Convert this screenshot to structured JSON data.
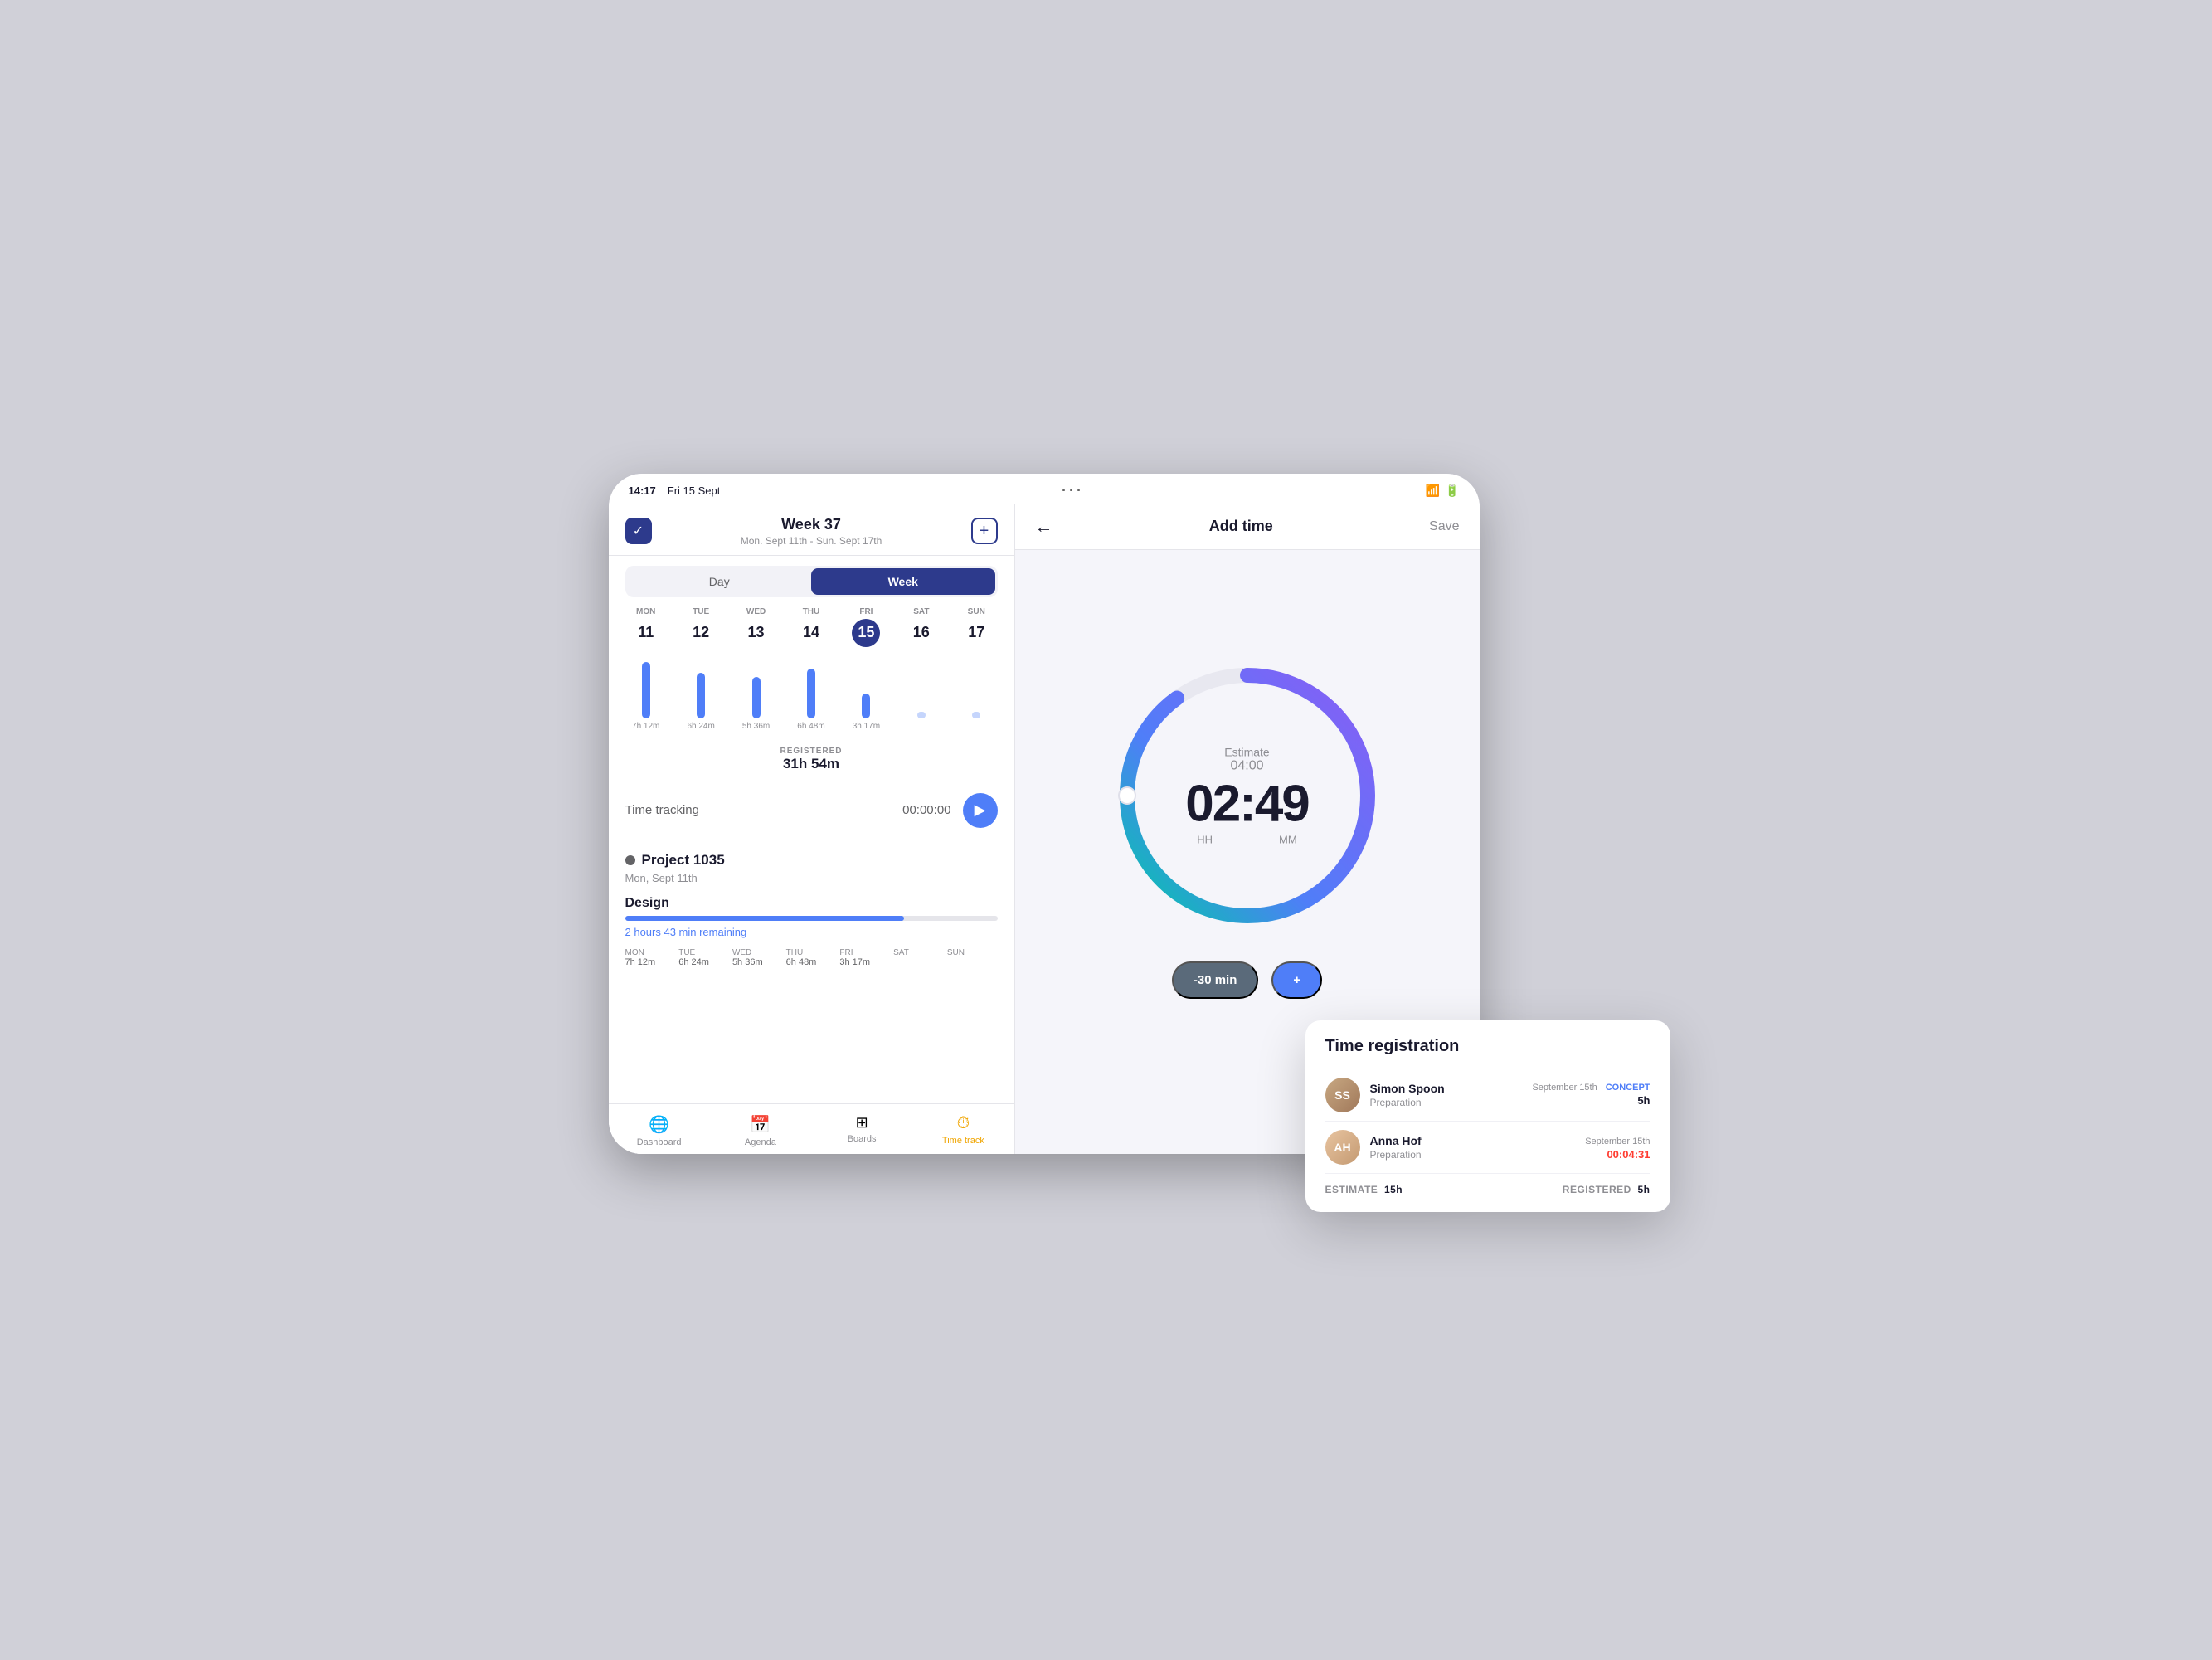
{
  "statusBar": {
    "time": "14:17",
    "date": "Fri 15 Sept"
  },
  "leftPanel": {
    "weekTitle": "Week 37",
    "weekSubtitle": "Mon. Sept 11th - Sun. Sept 17th",
    "toggleDay": "Day",
    "toggleWeek": "Week",
    "days": [
      {
        "label": "MON",
        "num": "11",
        "bar": 68,
        "time": "7h 12m",
        "active": false,
        "today": false
      },
      {
        "label": "TUE",
        "num": "12",
        "bar": 55,
        "time": "6h 24m",
        "active": false,
        "today": false
      },
      {
        "label": "WED",
        "num": "13",
        "bar": 50,
        "time": "5h 36m",
        "active": false,
        "today": false
      },
      {
        "label": "THU",
        "num": "14",
        "bar": 60,
        "time": "6h 48m",
        "active": false,
        "today": false
      },
      {
        "label": "FRI",
        "num": "15",
        "bar": 30,
        "time": "3h 17m",
        "active": true,
        "today": true
      },
      {
        "label": "SAT",
        "num": "16",
        "bar": 0,
        "time": "",
        "active": false,
        "today": false
      },
      {
        "label": "SUN",
        "num": "17",
        "bar": 0,
        "time": "",
        "active": false,
        "today": false
      }
    ],
    "registered": {
      "label": "REGISTERED",
      "value": "31h 54m"
    },
    "timeTracking": {
      "label": "Time tracking",
      "value": "00:00:00"
    },
    "project": {
      "name": "Project 1035",
      "date": "Mon, Sept 11th",
      "task": "Design",
      "remaining": "2 hours 43 min remaining",
      "progressPercent": 75
    },
    "miniWeek": {
      "days": [
        {
          "label": "MON",
          "val": "7h 12m"
        },
        {
          "label": "TUE",
          "val": "6h 24m"
        },
        {
          "label": "WED",
          "val": "5h 36m"
        },
        {
          "label": "THU",
          "val": "6h 48m"
        },
        {
          "label": "FRI",
          "val": "3h 17m"
        },
        {
          "label": "SAT",
          "val": ""
        },
        {
          "label": "SUN",
          "val": ""
        }
      ]
    }
  },
  "bottomNav": {
    "items": [
      {
        "label": "Dashboard",
        "icon": "🌐",
        "active": false
      },
      {
        "label": "Agenda",
        "icon": "📅",
        "active": false
      },
      {
        "label": "Boards",
        "icon": "⊞",
        "active": false
      },
      {
        "label": "Time track",
        "icon": "⏱",
        "active": true
      }
    ]
  },
  "rightPanel": {
    "title": "Add time",
    "saveLabel": "Save",
    "backIcon": "←",
    "estimate": {
      "label": "Estimate",
      "value": "04:00"
    },
    "timer": "02:49",
    "timerHH": "HH",
    "timerMM": "MM",
    "adjustButtons": [
      {
        "label": "-30 min",
        "type": "minus"
      },
      {
        "label": "+",
        "type": "plus"
      }
    ]
  },
  "timeRegPopup": {
    "title": "Time registration",
    "persons": [
      {
        "name": "Simon Spoon",
        "task": "Preparation",
        "date": "September 15th",
        "tag": "CONCEPT",
        "hours": "5h",
        "initials": "SS",
        "avatarClass": "av-simon"
      },
      {
        "name": "Anna Hof",
        "task": "Preparation",
        "date": "September 15th",
        "tag": "",
        "hours": "00:04:31",
        "hoursRed": true,
        "initials": "AH",
        "avatarClass": "av-anna"
      }
    ],
    "footer": {
      "estimateLabel": "ESTIMATE",
      "estimateValue": "15h",
      "registeredLabel": "REGISTERED",
      "registeredValue": "5h"
    }
  }
}
